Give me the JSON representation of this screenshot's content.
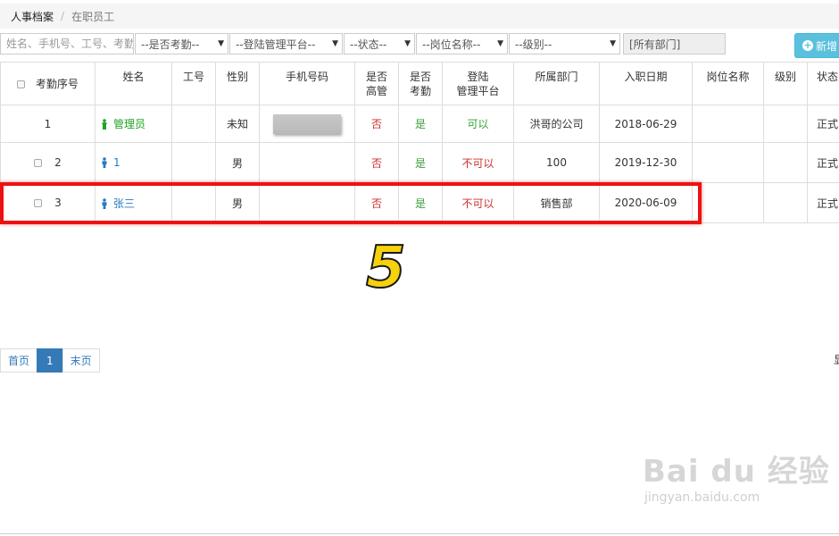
{
  "breadcrumb": {
    "root": "人事档案",
    "current": "在职员工"
  },
  "filters": {
    "search_placeholder": "姓名、手机号、工号、考勤",
    "attendance": "--是否考勤--",
    "login_platform": "--登陆管理平台--",
    "status": "--状态--",
    "position": "--岗位名称--",
    "level": "--级别--",
    "department": "[所有部门]",
    "add_label": "新增"
  },
  "table": {
    "headers": {
      "seq": "考勤序号",
      "name": "姓名",
      "job_no": "工号",
      "gender": "性别",
      "phone": "手机号码",
      "is_manager": "是否\n高管",
      "is_attendance": "是否\n考勤",
      "login": "登陆\n管理平台",
      "dept": "所属部门",
      "hire_date": "入职日期",
      "position": "岗位名称",
      "level": "级别",
      "status": "状态"
    },
    "rows": [
      {
        "seq": "1",
        "name": "管理员",
        "job_no": "",
        "gender": "未知",
        "is_manager": "否",
        "is_attendance": "是",
        "login": "可以",
        "dept": "洪哥的公司",
        "hire_date": "2018-06-29",
        "position": "",
        "level": "",
        "status": "正式"
      },
      {
        "seq": "2",
        "name": "1",
        "job_no": "",
        "gender": "男",
        "is_manager": "否",
        "is_attendance": "是",
        "login": "不可以",
        "dept": "100",
        "hire_date": "2019-12-30",
        "position": "",
        "level": "",
        "status": "正式"
      },
      {
        "seq": "3",
        "name": "张三",
        "job_no": "",
        "gender": "男",
        "is_manager": "否",
        "is_attendance": "是",
        "login": "不可以",
        "dept": "销售部",
        "hire_date": "2020-06-09",
        "position": "",
        "level": "",
        "status": "正式"
      }
    ]
  },
  "annotation": {
    "step_number": "5"
  },
  "pager": {
    "first": "首页",
    "current": "1",
    "last": "末页"
  },
  "edge_text": "显",
  "watermark": {
    "logo": "Bai du 经验",
    "url": "jingyan.baidu.com"
  },
  "colors": {
    "highlight": "#ee1111",
    "add_button": "#5bc0de",
    "pager_active": "#337ab7",
    "no_red": "#c9302c",
    "yes_green": "#3c9a3c"
  }
}
